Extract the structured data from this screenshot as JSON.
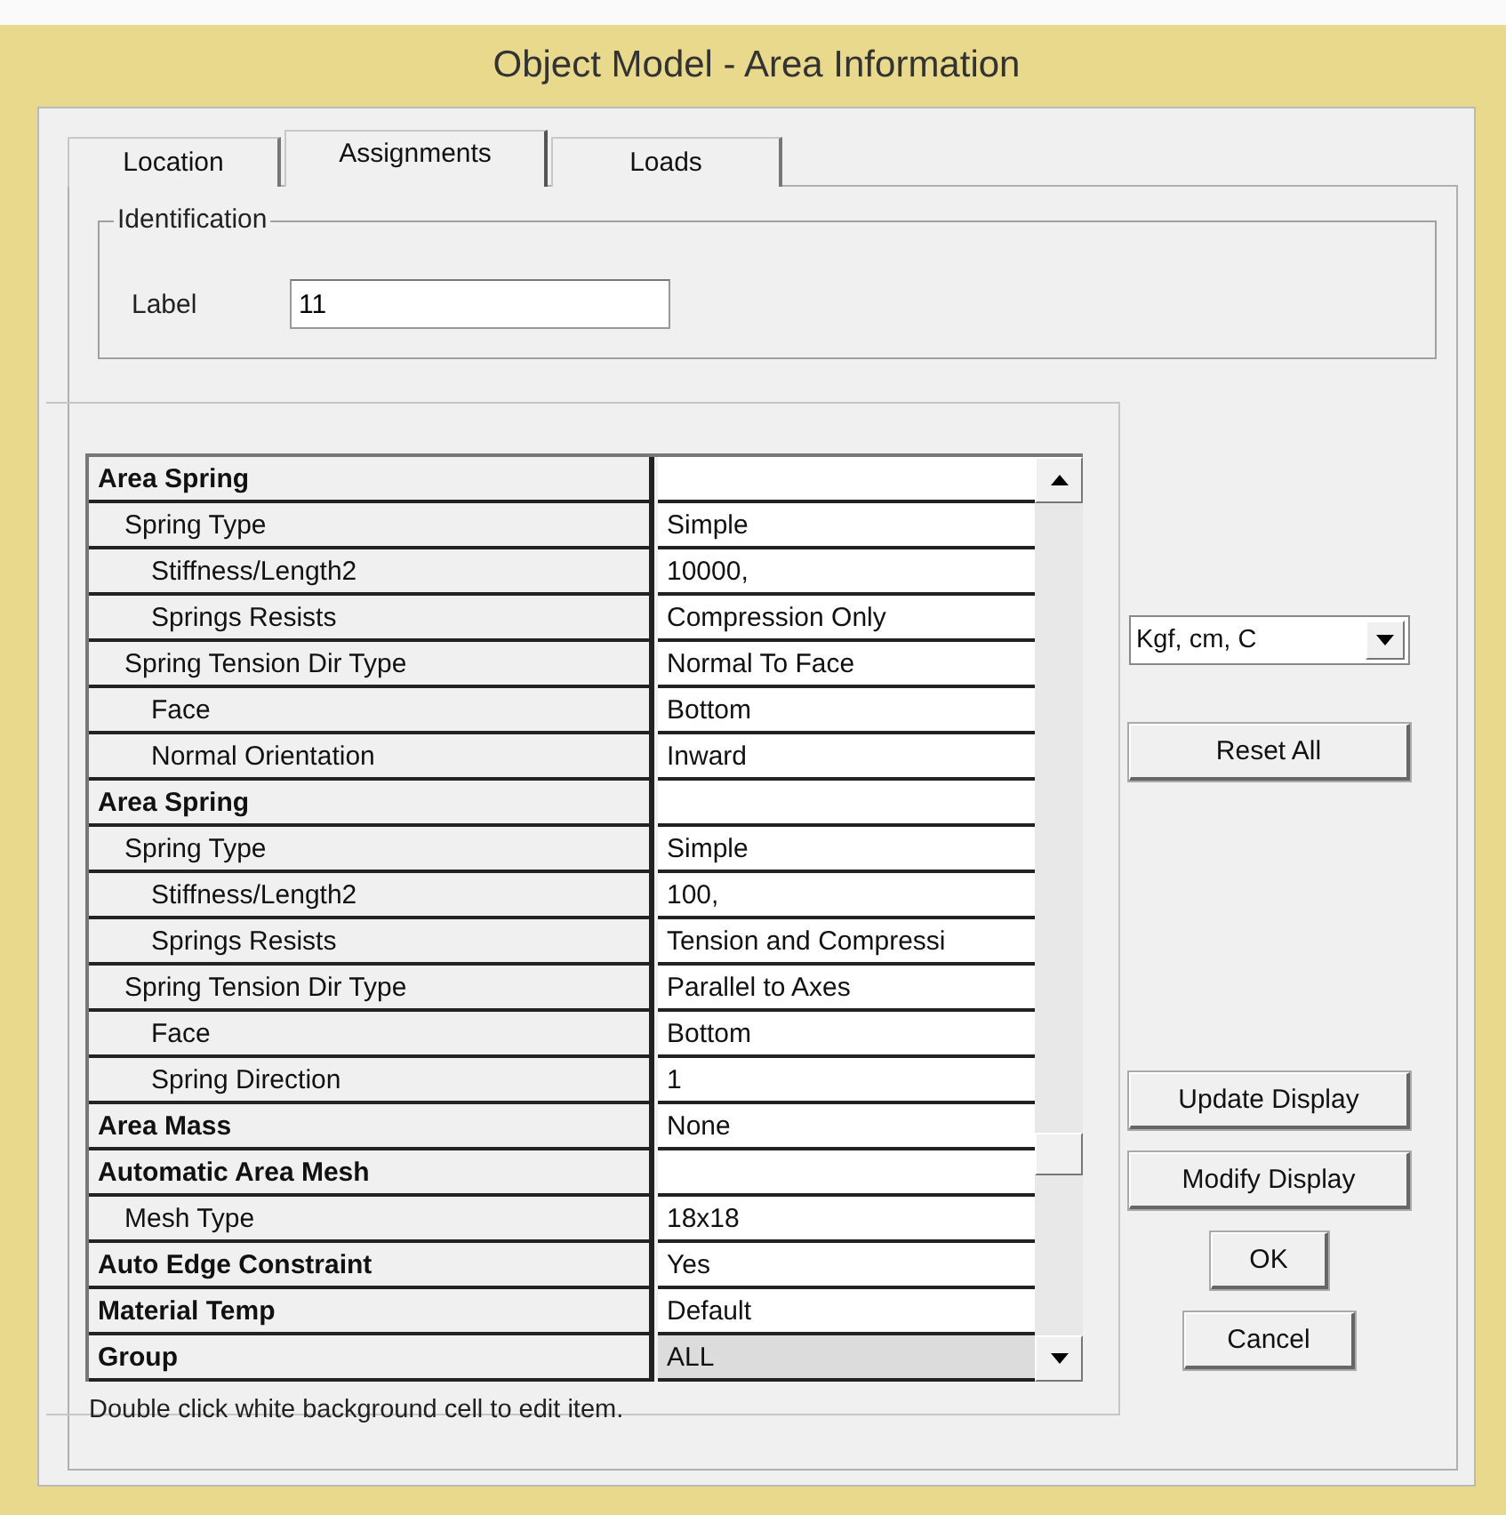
{
  "window": {
    "title": "Object Model - Area Information"
  },
  "tabs": [
    {
      "label": "Location",
      "selected": false
    },
    {
      "label": "Assignments",
      "selected": true
    },
    {
      "label": "Loads",
      "selected": false
    }
  ],
  "identification": {
    "title": "Identification",
    "label": "Label",
    "value": "11"
  },
  "properties": [
    {
      "label": "Area Spring",
      "selected": false,
      "children": [
        {
          "label": "Spring Type",
          "value": "Simple",
          "selected": false,
          "children": [
            {
              "label": "Stiffness/Length2",
              "value": "10000,",
              "selected": false
            },
            {
              "label": "Springs Resists",
              "value": "Compression Only",
              "selected": false
            }
          ]
        },
        {
          "label": "Spring Tension Dir Type",
          "value": "Normal To Face",
          "selected": false,
          "children": [
            {
              "label": "Face",
              "value": "Bottom",
              "selected": false
            },
            {
              "label": "Normal Orientation",
              "value": "Inward",
              "selected": false
            }
          ]
        }
      ]
    },
    {
      "label": "Area Spring",
      "selected": false,
      "children": [
        {
          "label": "Spring Type",
          "value": "Simple",
          "selected": false,
          "children": [
            {
              "label": "Stiffness/Length2",
              "value": "100,",
              "selected": false
            },
            {
              "label": "Springs Resists",
              "value": "Tension and Compressi",
              "selected": false
            }
          ]
        },
        {
          "label": "Spring Tension Dir Type",
          "value": "Parallel to Axes",
          "selected": false,
          "children": [
            {
              "label": "Face",
              "value": "Bottom",
              "selected": false
            },
            {
              "label": "Spring Direction",
              "value": "1",
              "selected": false
            }
          ]
        }
      ]
    },
    {
      "label": "Area Mass",
      "value": "None",
      "selected": false
    },
    {
      "label": "Automatic Area Mesh",
      "selected": false,
      "children": [
        {
          "label": "Mesh Type",
          "value": "18x18",
          "selected": false
        }
      ]
    },
    {
      "label": "Auto Edge Constraint",
      "value": "Yes",
      "selected": false
    },
    {
      "label": "Material Temp",
      "value": "Default",
      "selected": false
    },
    {
      "label": "Group",
      "value": "ALL",
      "selected": true
    }
  ],
  "hint": "Double click white background cell to edit item.",
  "units": {
    "value": "Kgf, cm, C"
  },
  "buttons": {
    "reset": "Reset All",
    "update": "Update Display",
    "modify": "Modify Display",
    "ok": "OK",
    "cancel": "Cancel"
  }
}
